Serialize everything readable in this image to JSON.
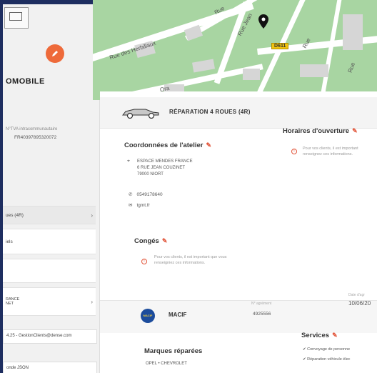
{
  "sidebar": {
    "company_name": "OMOBILE",
    "tva_label": "N°TVA intracommunautaire",
    "tva_value": "FR40397895320072",
    "items": [
      {
        "label": "ues (4R)",
        "chevron": "›"
      },
      {
        "label": "iels",
        "chevron": ""
      },
      {
        "label": "",
        "chevron": ""
      },
      {
        "label": "RANCE\nNET",
        "chevron": "›"
      }
    ],
    "email": "4.25 - GestionClients@dense.com",
    "json_label": "onde JSON"
  },
  "map": {
    "labels": [
      "Rue des Herbillaux",
      "Rue",
      "Rue Jean",
      "Rue",
      "Rue",
      "Ora"
    ],
    "road_badge": "D611"
  },
  "main": {
    "title": "RÉPARATION 4 ROUES (4R)",
    "workshop": {
      "title": "Coordonnées de l'atelier",
      "address": [
        "ESPACE MENDES FRANCE",
        "6 RUE JEAN COUZINET",
        "79000 NIORT"
      ],
      "phone": "0549178640",
      "email": "tgmt.fr"
    },
    "hours": {
      "title": "Horaires d'ouverture",
      "warning": "Pour vos clients, il est important\nrenseignez ces informations."
    },
    "conges": {
      "title": "Congés",
      "warning": "Pour vos clients, il est important que vous\nrenseigniez ces informations."
    },
    "insurance": {
      "name": "MACIF",
      "agreement_label": "N° agrément",
      "agreement_value": "4925556",
      "date_label": "Date d'agr",
      "date_value": "10/06/20"
    },
    "brands": {
      "title": "Marques réparées",
      "values": "OPEL  •  CHEVROLET"
    },
    "services": {
      "title": "Services",
      "items": [
        "Convoyage de personne",
        "Réparation véhicule élec"
      ]
    }
  },
  "colors": {
    "accent": "#e2553a",
    "frame": "#1e2e60",
    "map_green": "#a8d5a2",
    "badge": "#f1c40f"
  }
}
